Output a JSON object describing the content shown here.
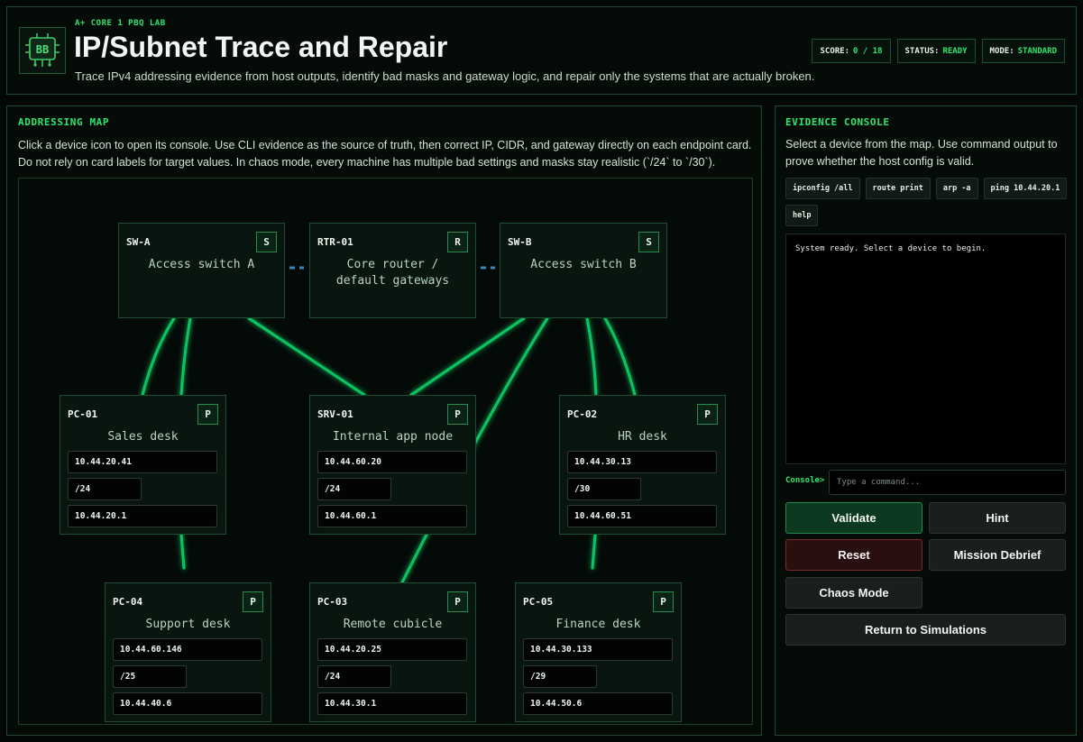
{
  "header": {
    "eyebrow": "A+ CORE 1 PBQ LAB",
    "logo_text": "BB",
    "title": "IP/Subnet Trace and Repair",
    "subtitle": "Trace IPv4 addressing evidence from host outputs, identify bad masks and gateway logic, and repair only the systems that are actually broken.",
    "score_label": "SCORE:",
    "score_value": "0 / 18",
    "status_label": "STATUS:",
    "status_value": "READY",
    "mode_label": "MODE:",
    "mode_value": "STANDARD"
  },
  "map": {
    "title": "ADDRESSING MAP",
    "description": "Click a device icon to open its console. Use CLI evidence as the source of truth, then correct IP, CIDR, and gateway directly on each endpoint card. Do not rely on card labels for target values. In chaos mode, every machine has multiple bad settings and masks stay realistic (`/24` to `/30`).",
    "infra": [
      {
        "id": "SW-A",
        "tag": "S",
        "name": "Access switch A"
      },
      {
        "id": "RTR-01",
        "tag": "R",
        "name": "Core router / default gateways"
      },
      {
        "id": "SW-B",
        "tag": "S",
        "name": "Access switch B"
      }
    ],
    "endpoints": [
      {
        "id": "PC-01",
        "tag": "P",
        "name": "Sales desk",
        "ip": "10.44.20.41",
        "cidr": "/24",
        "gateway": "10.44.20.1"
      },
      {
        "id": "SRV-01",
        "tag": "P",
        "name": "Internal app node",
        "ip": "10.44.60.20",
        "cidr": "/24",
        "gateway": "10.44.60.1"
      },
      {
        "id": "PC-02",
        "tag": "P",
        "name": "HR desk",
        "ip": "10.44.30.13",
        "cidr": "/30",
        "gateway": "10.44.60.51"
      },
      {
        "id": "PC-04",
        "tag": "P",
        "name": "Support desk",
        "ip": "10.44.60.146",
        "cidr": "/25",
        "gateway": "10.44.40.6"
      },
      {
        "id": "PC-03",
        "tag": "P",
        "name": "Remote cubicle",
        "ip": "10.44.20.25",
        "cidr": "/24",
        "gateway": "10.44.30.1"
      },
      {
        "id": "PC-05",
        "tag": "P",
        "name": "Finance desk",
        "ip": "10.44.30.133",
        "cidr": "/29",
        "gateway": "10.44.50.6"
      }
    ]
  },
  "evidence": {
    "title": "EVIDENCE CONSOLE",
    "description": "Select a device from the map. Use command output to prove whether the host config is valid.",
    "commands": [
      "ipconfig /all",
      "route print",
      "arp -a",
      "ping 10.44.20.1",
      "help"
    ],
    "output": "System ready. Select a device to begin.",
    "prompt": "Console>",
    "input_placeholder": "Type a command...",
    "buttons": {
      "validate": "Validate",
      "hint": "Hint",
      "reset": "Reset",
      "debrief": "Mission Debrief",
      "chaos": "Chaos Mode",
      "return": "Return to Simulations"
    }
  },
  "colors": {
    "accent": "#2ee66f",
    "link": "#10c060",
    "uplink": "#3a86b8",
    "background": "#030806"
  }
}
